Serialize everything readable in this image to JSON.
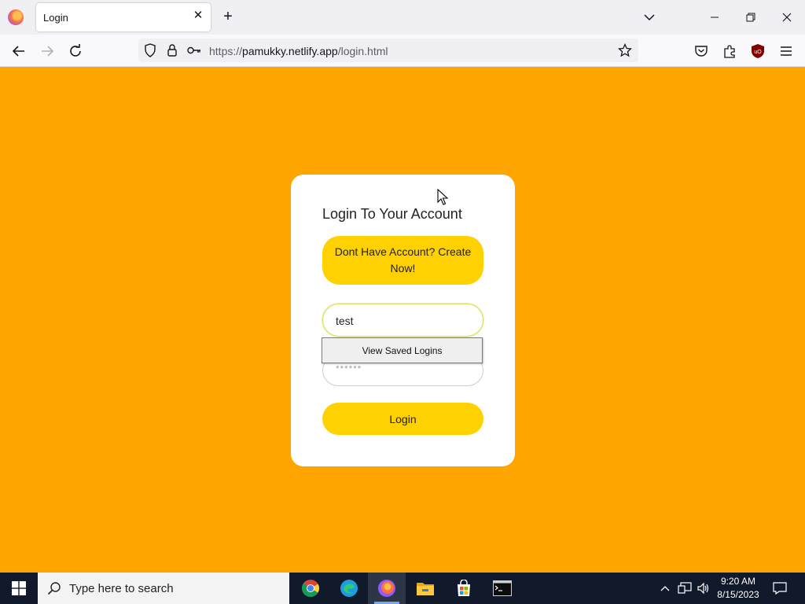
{
  "browser": {
    "tab_title": "Login",
    "url_scheme": "https://",
    "url_host": "pamukky.netlify.app",
    "url_path": "/login.html"
  },
  "page": {
    "background": "#ffa500",
    "card_title": "Login To Your Account",
    "signup_button": "Dont Have Account? Create Now!",
    "username_value": "test",
    "password_value": "••••••",
    "login_button": "Login",
    "autofill_label": "View Saved Logins",
    "accent": "#ffd100"
  },
  "taskbar": {
    "search_placeholder": "Type here to search",
    "time": "9:20 AM",
    "date": "8/15/2023",
    "apps": [
      "chrome-icon",
      "edge-icon",
      "firefox-icon",
      "file-explorer-icon",
      "store-icon",
      "terminal-icon"
    ]
  }
}
